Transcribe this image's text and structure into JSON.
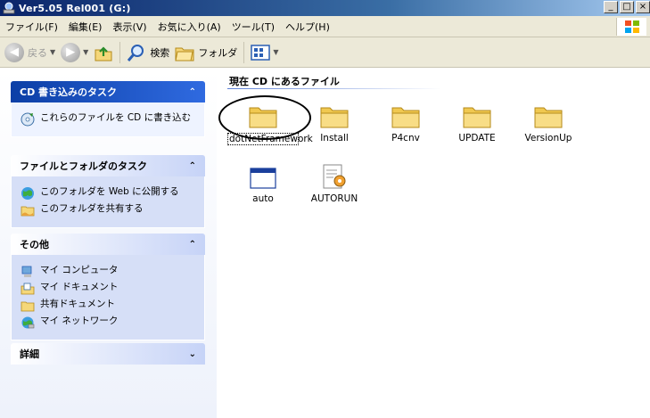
{
  "window": {
    "title": "Ver5.05 Rel001  (G:)",
    "controls": [
      "_",
      "□",
      "×"
    ]
  },
  "menu": [
    "ファイル(F)",
    "編集(E)",
    "表示(V)",
    "お気に入り(A)",
    "ツール(T)",
    "ヘルプ(H)"
  ],
  "toolbar": {
    "back_label": "戻る",
    "search_label": "検索",
    "folders_label": "フォルダ"
  },
  "taskpane": {
    "cd_tasks": {
      "title": "CD 書き込みのタスク",
      "items": [
        {
          "label": "これらのファイルを CD に書き込む",
          "icon": "cd-write-icon"
        }
      ]
    },
    "file_tasks": {
      "title": "ファイルとフォルダのタスク",
      "items": [
        {
          "label": "このフォルダを Web に公開する",
          "icon": "web-publish-icon"
        },
        {
          "label": "このフォルダを共有する",
          "icon": "share-folder-icon"
        }
      ]
    },
    "other": {
      "title": "その他",
      "items": [
        {
          "label": "マイ コンピュータ",
          "icon": "my-computer-icon"
        },
        {
          "label": "マイ ドキュメント",
          "icon": "my-documents-icon"
        },
        {
          "label": "共有ドキュメント",
          "icon": "shared-documents-icon"
        },
        {
          "label": "マイ ネットワーク",
          "icon": "my-network-icon"
        }
      ]
    },
    "details": {
      "title": "詳細"
    }
  },
  "content": {
    "section_title": "現在 CD にあるファイル",
    "files": [
      {
        "name": "dotNetFramework",
        "type": "folder",
        "selected": true
      },
      {
        "name": "Install",
        "type": "folder"
      },
      {
        "name": "P4cnv",
        "type": "folder"
      },
      {
        "name": "UPDATE",
        "type": "folder"
      },
      {
        "name": "VersionUp",
        "type": "folder"
      },
      {
        "name": "auto",
        "type": "application"
      },
      {
        "name": "AUTORUN",
        "type": "setup-info"
      }
    ]
  },
  "colors": {
    "titlebar_start": "#0a246a",
    "taskpane_header": "#0c3fa6",
    "folder": "#f5d779"
  }
}
